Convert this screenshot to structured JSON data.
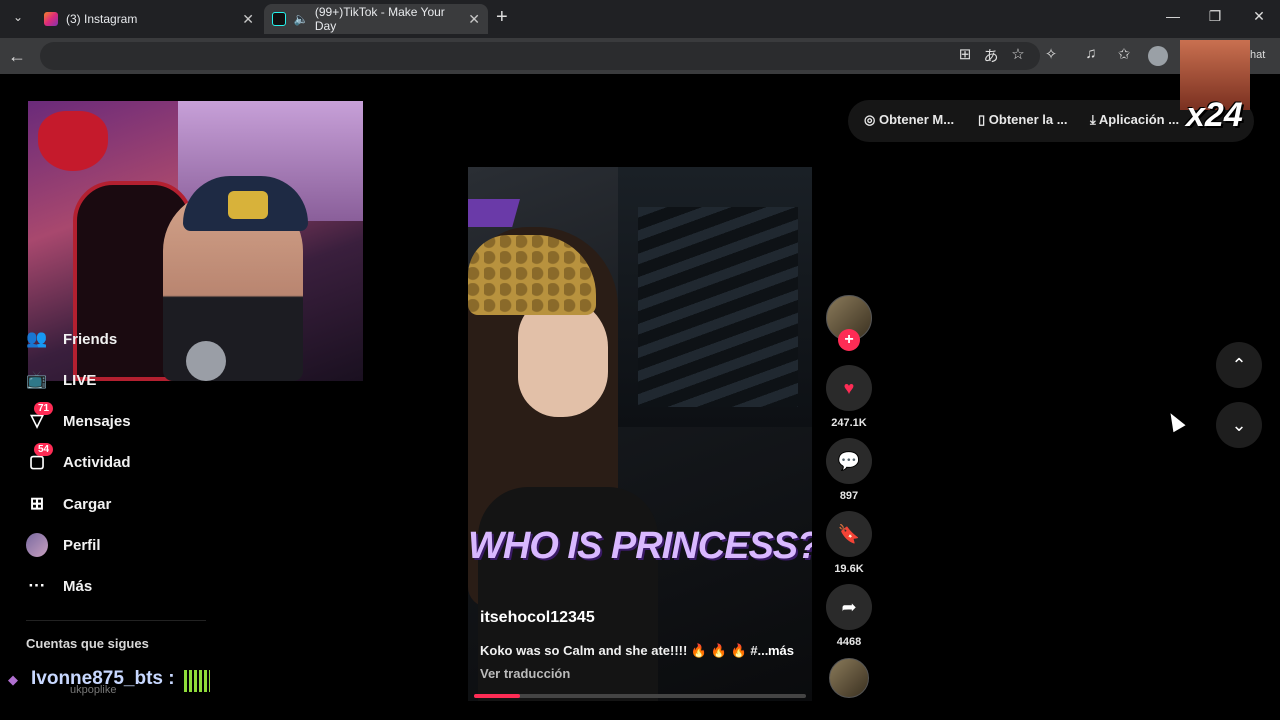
{
  "browser": {
    "tabs": [
      {
        "label": "(3) Instagram",
        "icon": "instagram-icon"
      },
      {
        "label": "(99+)TikTok - Make Your Day",
        "icon": "tiktok-icon",
        "audio_icon": "speaker-icon",
        "active": true
      }
    ],
    "new_tab": "+",
    "tab_list_icon": "chevron-down-icon",
    "window_controls": {
      "minimize": "—",
      "maximize": "❐",
      "close": "✕"
    },
    "tab_close": "✕",
    "back_icon": "←",
    "toolbar_icons": [
      "app-grid-icon",
      "translate-icon",
      "favorite-star-icon",
      "extensions-icon",
      "media-icon",
      "favorites-icon"
    ],
    "chat_label": "hat"
  },
  "top_actions": {
    "get_m": "Obtener M...",
    "get_la": "Obtener la ...",
    "app": "Aplicación ..."
  },
  "overlay": {
    "multiplier": "x24"
  },
  "sidebar": {
    "items": [
      {
        "label": "Friends",
        "icon": "friends-icon"
      },
      {
        "label": "LIVE",
        "icon": "live-icon"
      },
      {
        "label": "Mensajes",
        "icon": "messages-icon",
        "badge": "71"
      },
      {
        "label": "Actividad",
        "icon": "activity-icon",
        "badge": "54"
      },
      {
        "label": "Cargar",
        "icon": "upload-icon"
      },
      {
        "label": "Perfil",
        "icon": "profile-avatar"
      },
      {
        "label": "Más",
        "icon": "more-icon"
      }
    ],
    "following_title": "Cuentas que sigues",
    "following_sub": "ukpoplike"
  },
  "chat_overlay": {
    "name": "Ivonne875_bts :"
  },
  "video": {
    "caption": "WHO IS PRINCESS?",
    "author": "itsehocol12345",
    "description": "Koko was so Calm and she ate!!!! 🔥 🔥 🔥 #...",
    "more": "más",
    "translate": "Ver traducción",
    "progress": 0.14
  },
  "actions": {
    "likes": "247.1K",
    "comments": "897",
    "saves": "19.6K",
    "shares": "4468"
  },
  "colors": {
    "accent": "#fe2c55",
    "background": "#000000"
  }
}
